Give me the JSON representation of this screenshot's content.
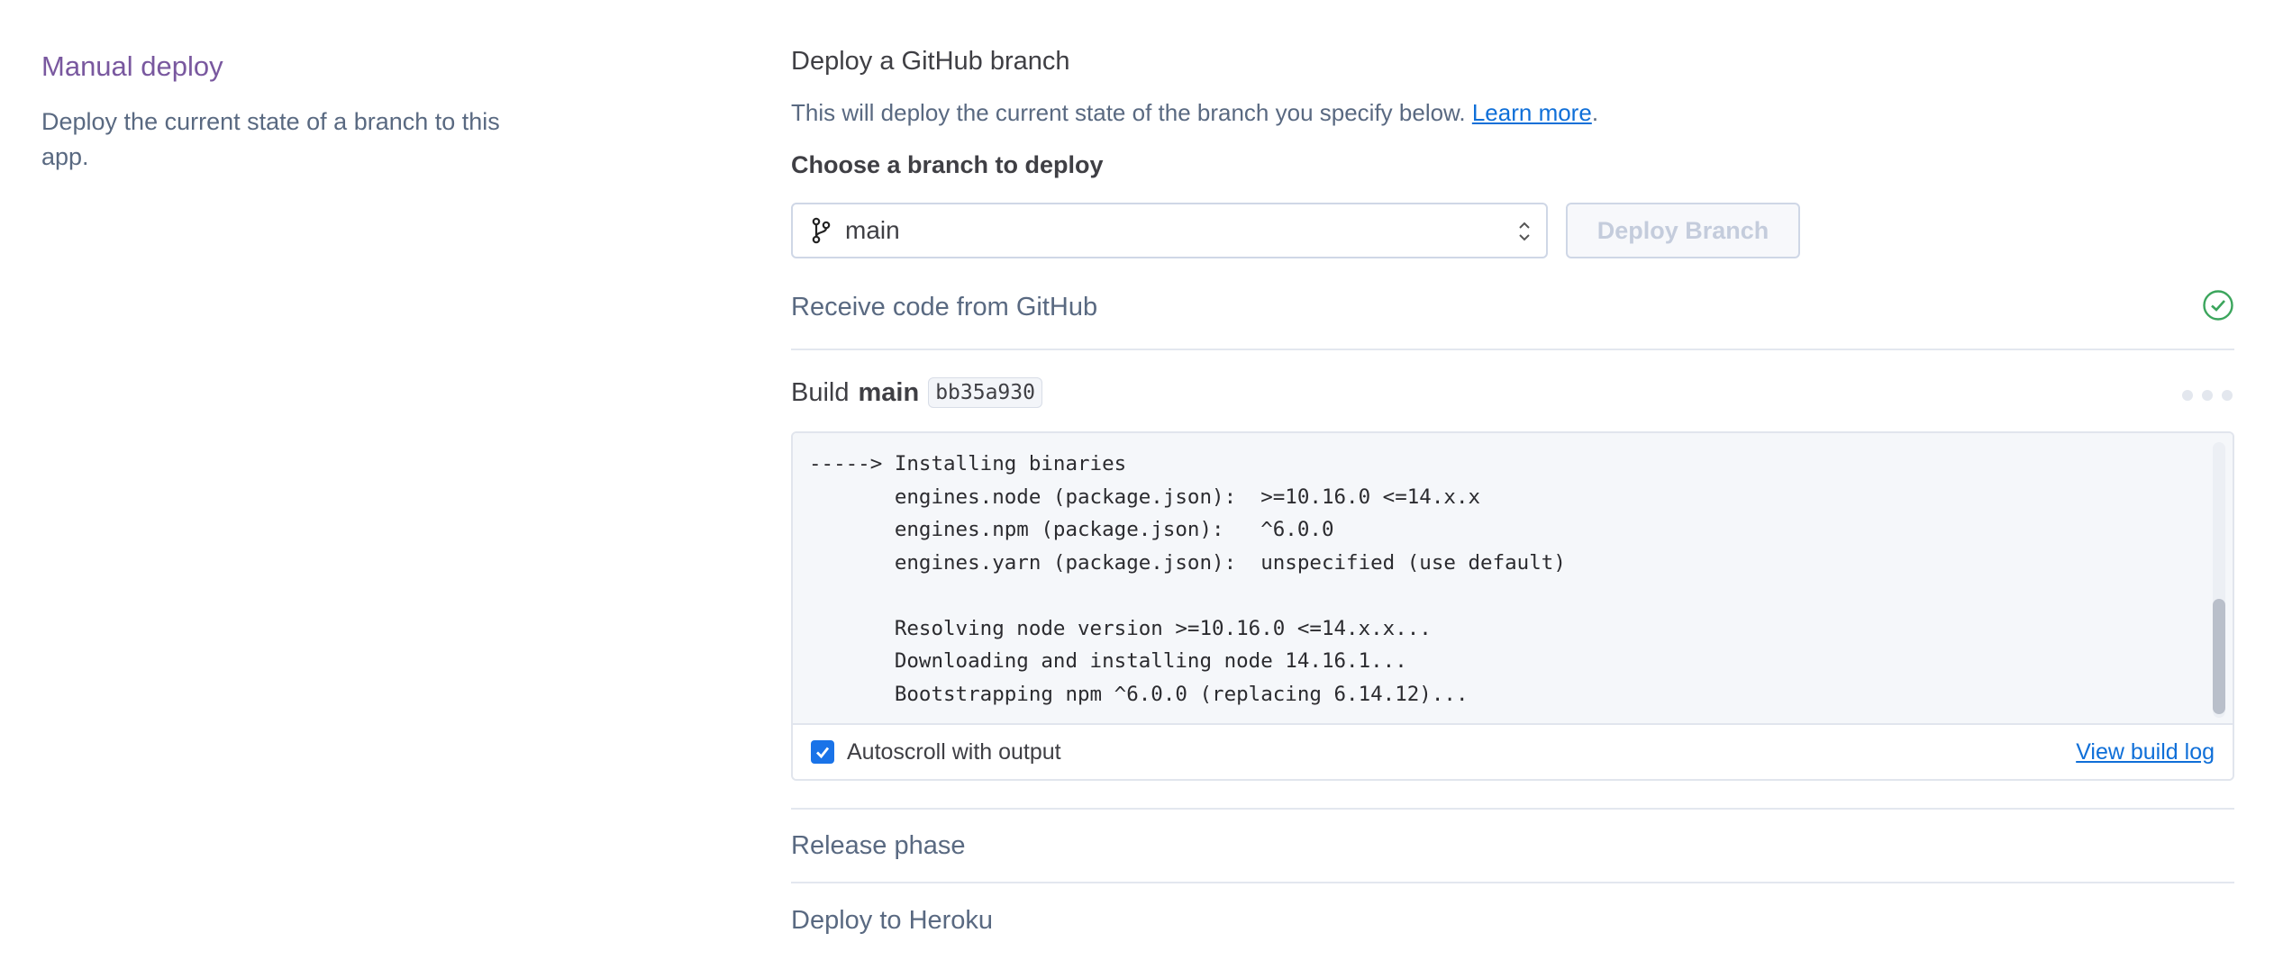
{
  "left": {
    "title": "Manual deploy",
    "description": "Deploy the current state of a branch to this app."
  },
  "deploy": {
    "heading": "Deploy a GitHub branch",
    "info_text": "This will deploy the current state of the branch you specify below. ",
    "learn_more": "Learn more",
    "info_suffix": ".",
    "choose_label": "Choose a branch to deploy",
    "branch_value": "main",
    "deploy_button": "Deploy Branch"
  },
  "steps": {
    "receive": "Receive code from GitHub",
    "build_label": "Build",
    "build_branch": "main",
    "build_sha": "bb35a930",
    "release": "Release phase",
    "heroku": "Deploy to Heroku"
  },
  "log": {
    "lines": "-----> Installing binaries\n       engines.node (package.json):  >=10.16.0 <=14.x.x\n       engines.npm (package.json):   ^6.0.0\n       engines.yarn (package.json):  unspecified (use default)\n\n       Resolving node version >=10.16.0 <=14.x.x...\n       Downloading and installing node 14.16.1...\n       Bootstrapping npm ^6.0.0 (replacing 6.14.12)...",
    "autoscroll_label": "Autoscroll with output",
    "autoscroll_checked": true,
    "view_build_log": "View build log"
  },
  "colors": {
    "accent": "#79589f",
    "link": "#0f6fd8",
    "success": "#3ba55c",
    "checkbox": "#1a73e8"
  },
  "icons": [
    "branch-icon",
    "updown-chevron-icon",
    "check-circle-icon",
    "more-dots-icon",
    "checkmark-icon"
  ]
}
